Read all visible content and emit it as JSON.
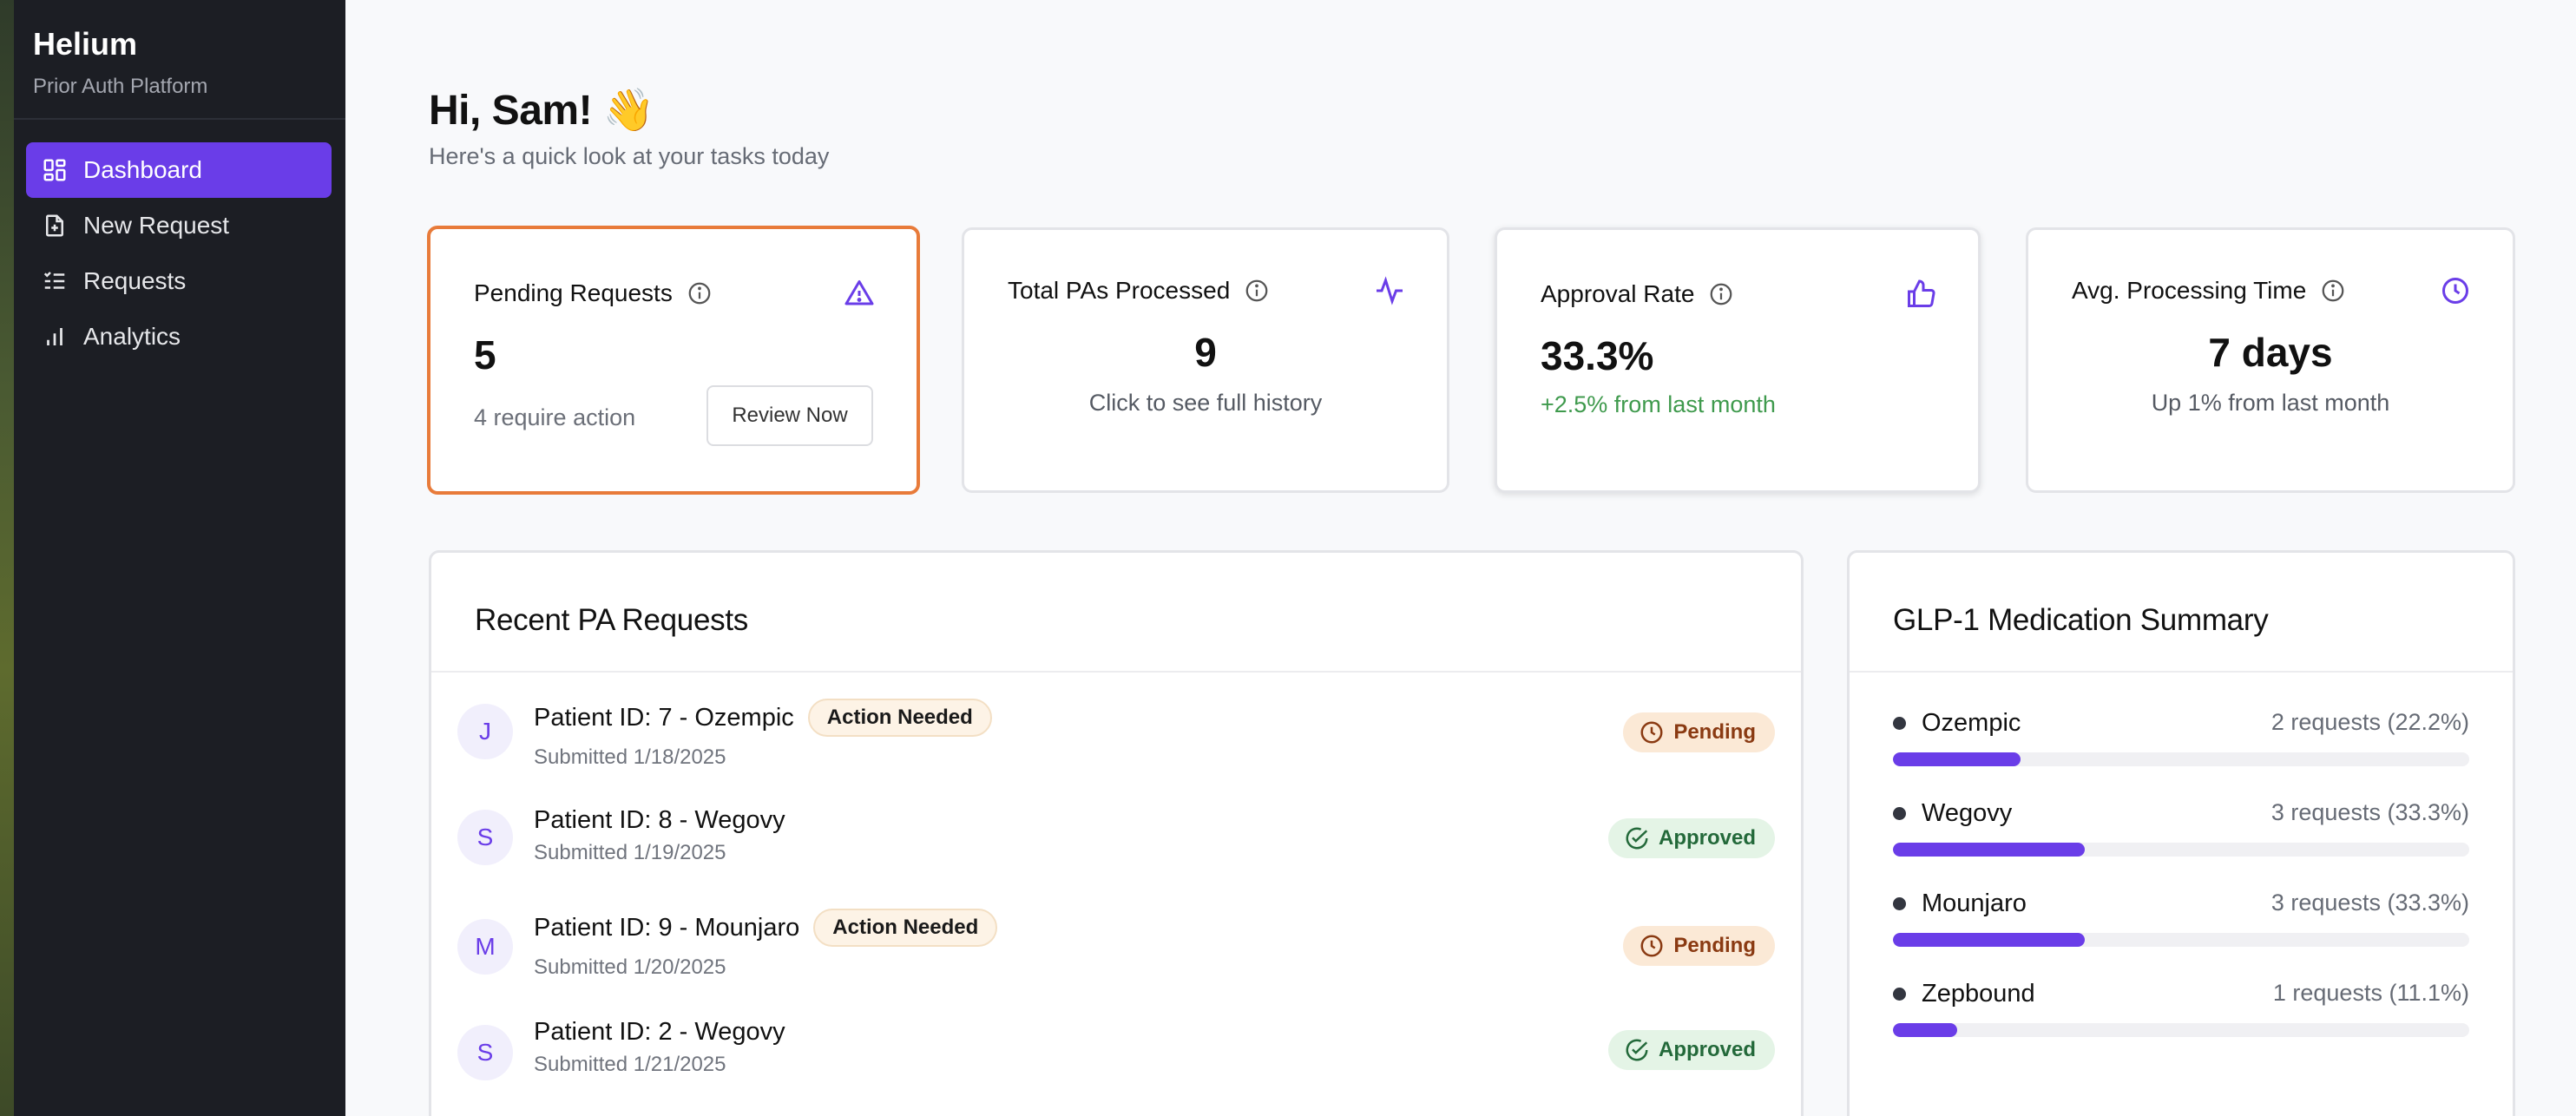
{
  "sidebar": {
    "brand_title": "Helium",
    "brand_subtitle": "Prior Auth Platform",
    "items": [
      {
        "label": "Dashboard",
        "icon": "dashboard-icon",
        "active": true
      },
      {
        "label": "New Request",
        "icon": "file-plus-icon",
        "active": false
      },
      {
        "label": "Requests",
        "icon": "list-check-icon",
        "active": false
      },
      {
        "label": "Analytics",
        "icon": "bar-chart-icon",
        "active": false
      }
    ]
  },
  "greeting": {
    "title": "Hi, Sam! 👋",
    "subtitle": "Here's a quick look at your tasks today"
  },
  "stats": {
    "pending": {
      "label": "Pending Requests",
      "value": "5",
      "note": "4 require action",
      "button": "Review Now",
      "icon": "warning-triangle-icon"
    },
    "total": {
      "label": "Total PAs Processed",
      "value": "9",
      "note": "Click to see full history",
      "icon": "activity-pulse-icon"
    },
    "approval": {
      "label": "Approval Rate",
      "value": "33.3%",
      "note": "+2.5% from last month",
      "icon": "thumbs-up-icon"
    },
    "avg_time": {
      "label": "Avg. Processing Time",
      "value": "7 days",
      "note": "Up 1% from last month",
      "icon": "clock-icon"
    }
  },
  "recent": {
    "title": "Recent PA Requests",
    "rows": [
      {
        "initial": "J",
        "title": "Patient ID: 7 - Ozempic",
        "badge": "Action Needed",
        "submitted": "Submitted 1/18/2025",
        "status": "Pending"
      },
      {
        "initial": "S",
        "title": "Patient ID: 8 - Wegovy",
        "badge": "",
        "submitted": "Submitted 1/19/2025",
        "status": "Approved"
      },
      {
        "initial": "M",
        "title": "Patient ID: 9 - Mounjaro",
        "badge": "Action Needed",
        "submitted": "Submitted 1/20/2025",
        "status": "Pending"
      },
      {
        "initial": "S",
        "title": "Patient ID: 2 - Wegovy",
        "badge": "",
        "submitted": "Submitted 1/21/2025",
        "status": "Approved"
      }
    ]
  },
  "summary": {
    "title": "GLP-1 Medication Summary",
    "items": [
      {
        "name": "Ozempic",
        "count": "2 requests (22.2%)",
        "share": 0.222
      },
      {
        "name": "Wegovy",
        "count": "3 requests (33.3%)",
        "share": 0.333
      },
      {
        "name": "Mounjaro",
        "count": "3 requests (33.3%)",
        "share": 0.333
      },
      {
        "name": "Zepbound",
        "count": "1 requests (11.1%)",
        "share": 0.111
      }
    ]
  },
  "colors": {
    "accent": "#6a3de8",
    "highlight_border": "#e87b3a",
    "positive": "#3f9a4d"
  }
}
